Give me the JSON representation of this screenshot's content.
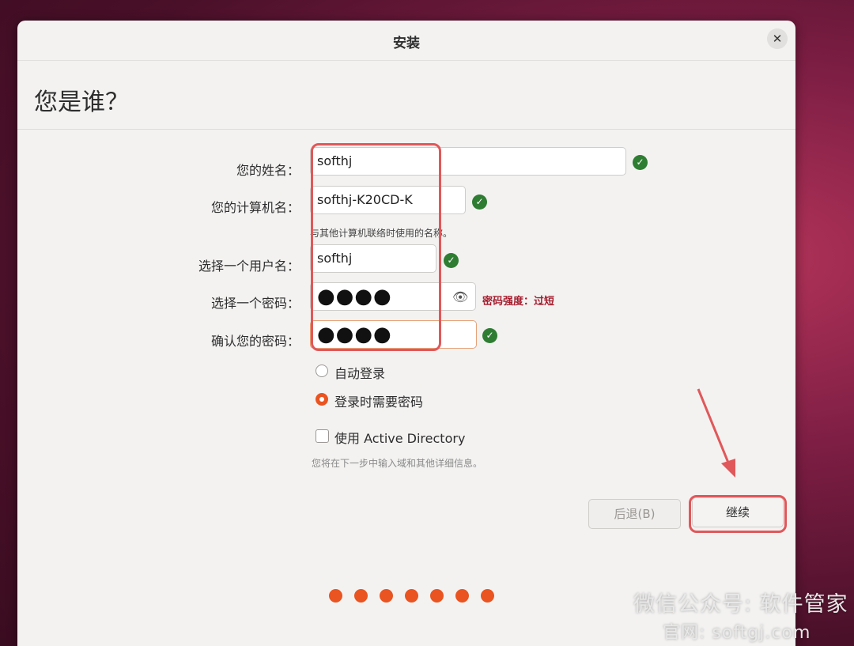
{
  "window": {
    "title": "安装",
    "close_glyph": "✕"
  },
  "page": {
    "heading": "您是谁？"
  },
  "form": {
    "name_label": "您的姓名：",
    "name_value": "softhj",
    "computer_label": "您的计算机名：",
    "computer_value": "softhj-K20CD-K",
    "computer_hint": "与其他计算机联络时使用的名称。",
    "username_label": "选择一个用户名：",
    "username_value": "softhj",
    "password_label": "选择一个密码：",
    "password_value": "●●●●",
    "password_strength": "密码强度：过短",
    "confirm_label": "确认您的密码：",
    "confirm_value": "●●●●"
  },
  "options": {
    "auto_login": "自动登录",
    "require_password": "登录时需要密码",
    "active_directory": "使用 Active Directory",
    "ad_hint": "您将在下一步中输入域和其他详细信息。"
  },
  "buttons": {
    "back": "后退(B)",
    "continue": "继续"
  },
  "progress": {
    "total_steps": 7
  },
  "watermark": {
    "line1": "微信公众号: 软件管家",
    "line2": "官网: softgj.com"
  },
  "colors": {
    "accent": "#e95420",
    "valid": "#2e7d32",
    "warning": "#a51d2d",
    "annotation": "#e0585a"
  },
  "icons": {
    "valid": "check-circle-icon",
    "reveal": "eye-icon",
    "close": "close-icon"
  }
}
